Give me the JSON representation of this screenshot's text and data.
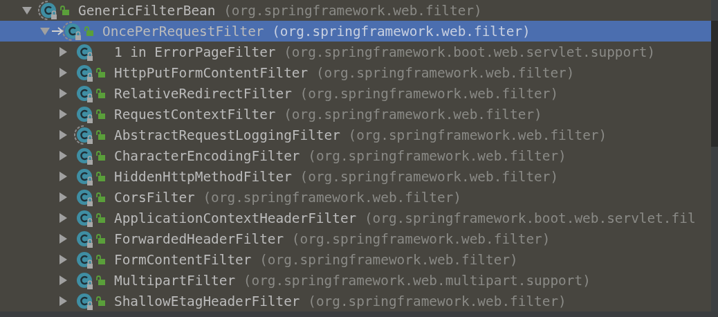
{
  "tree": [
    {
      "name": "GenericFilterBean",
      "package": "(org.springframework.web.filter)",
      "kind": "abstract",
      "public": true,
      "expanded": true,
      "selected": false,
      "children": [
        {
          "name": "OncePerRequestFilter",
          "package": "(org.springframework.web.filter)",
          "kind": "abstract",
          "public": true,
          "arrow": true,
          "expanded": true,
          "selected": true,
          "children": [
            {
              "name": "1 in ErrorPageFilter",
              "package": "(org.springframework.boot.web.servlet.support)",
              "kind": "class",
              "public": false,
              "expanded": false,
              "selected": false
            },
            {
              "name": "HttpPutFormContentFilter",
              "package": "(org.springframework.web.filter)",
              "kind": "class",
              "public": true,
              "expanded": false,
              "selected": false
            },
            {
              "name": "RelativeRedirectFilter",
              "package": "(org.springframework.web.filter)",
              "kind": "class",
              "public": true,
              "expanded": false,
              "selected": false
            },
            {
              "name": "RequestContextFilter",
              "package": "(org.springframework.web.filter)",
              "kind": "class",
              "public": true,
              "expanded": false,
              "selected": false
            },
            {
              "name": "AbstractRequestLoggingFilter",
              "package": "(org.springframework.web.filter)",
              "kind": "abstract",
              "public": true,
              "expanded": false,
              "selected": false
            },
            {
              "name": "CharacterEncodingFilter",
              "package": "(org.springframework.web.filter)",
              "kind": "class",
              "public": true,
              "expanded": false,
              "selected": false
            },
            {
              "name": "HiddenHttpMethodFilter",
              "package": "(org.springframework.web.filter)",
              "kind": "class",
              "public": true,
              "expanded": false,
              "selected": false
            },
            {
              "name": "CorsFilter",
              "package": "(org.springframework.web.filter)",
              "kind": "class",
              "public": true,
              "expanded": false,
              "selected": false
            },
            {
              "name": "ApplicationContextHeaderFilter",
              "package": "(org.springframework.boot.web.servlet.fil",
              "kind": "class",
              "public": true,
              "expanded": false,
              "selected": false
            },
            {
              "name": "ForwardedHeaderFilter",
              "package": "(org.springframework.web.filter)",
              "kind": "class",
              "public": true,
              "expanded": false,
              "selected": false
            },
            {
              "name": "FormContentFilter",
              "package": "(org.springframework.web.filter)",
              "kind": "class",
              "public": true,
              "expanded": false,
              "selected": false
            },
            {
              "name": "MultipartFilter",
              "package": "(org.springframework.web.multipart.support)",
              "kind": "class",
              "public": true,
              "expanded": false,
              "selected": false
            },
            {
              "name": "ShallowEtagHeaderFilter",
              "package": "(org.springframework.web.filter)",
              "kind": "class",
              "public": true,
              "expanded": false,
              "selected": false
            }
          ]
        }
      ]
    }
  ]
}
